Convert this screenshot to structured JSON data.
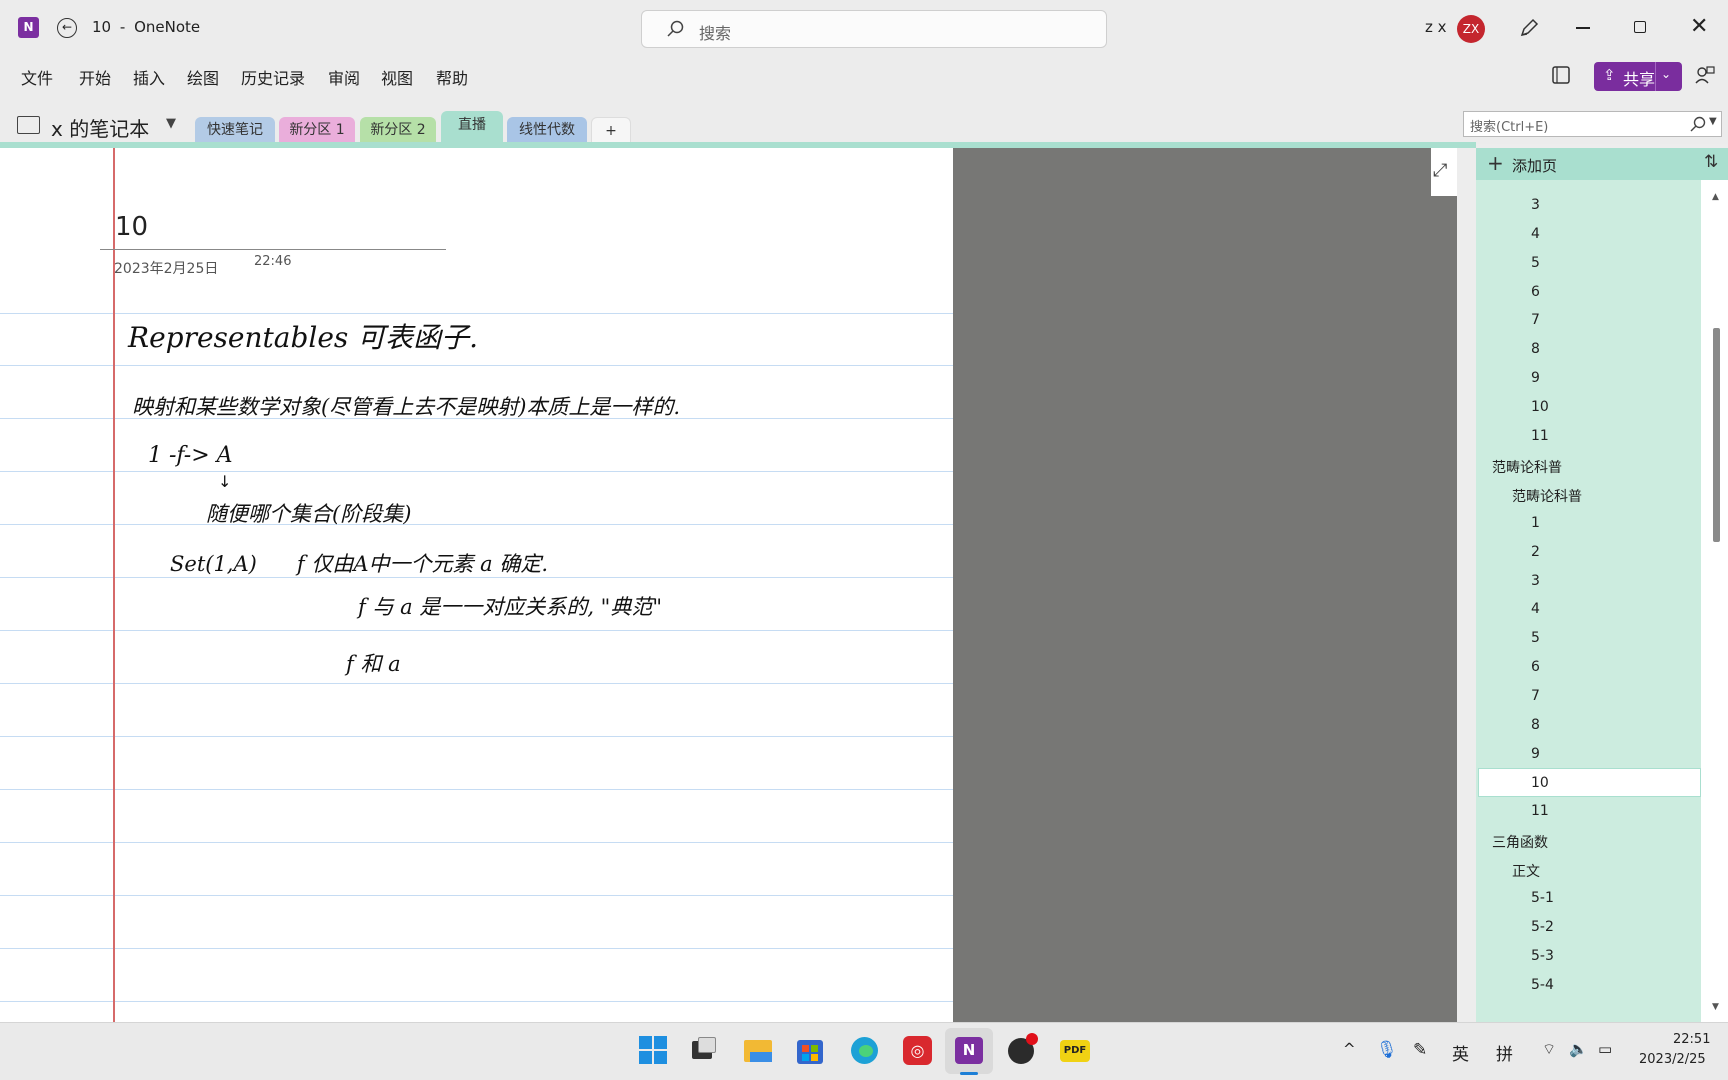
{
  "window": {
    "page_name": "10",
    "separator": "-",
    "app_name": "OneNote",
    "user_initials_text": "z x",
    "avatar_initials": "ZX"
  },
  "search": {
    "placeholder": "搜索"
  },
  "menu": [
    "文件",
    "开始",
    "插入",
    "绘图",
    "历史记录",
    "审阅",
    "视图",
    "帮助"
  ],
  "share_label": "共享",
  "notebook": {
    "name": "x 的笔记本",
    "sections": [
      {
        "label": "快速笔记",
        "color": "#b3cbe6"
      },
      {
        "label": "新分区 1",
        "color": "#eaaedb"
      },
      {
        "label": "新分区 2",
        "color": "#b6e0a8"
      },
      {
        "label": "直播",
        "color": "#a9dfcf"
      },
      {
        "label": "线性代数",
        "color": "#a9c5e6"
      }
    ],
    "add_section": "+"
  },
  "page_search": {
    "placeholder": "搜索(Ctrl+E)"
  },
  "page": {
    "title": "10",
    "date": "2023年2月25日",
    "time": "22:46",
    "ink": [
      "Representables   可表函子.",
      "映射和某些数学对象(尽管看上去不是映射)本质上是一样的.",
      "1 -f-> A",
      "随便哪个集合(阶段集)",
      "Set(1,A)      f 仅由A中一个元素 a 确定.",
      "f 与 a 是一一对应关系的, \"典范\"",
      "f 和 a"
    ]
  },
  "pagelist": {
    "add_page": "添加页",
    "items": [
      {
        "label": "3",
        "level": 2
      },
      {
        "label": "4",
        "level": 2
      },
      {
        "label": "5",
        "level": 2
      },
      {
        "label": "6",
        "level": 2
      },
      {
        "label": "7",
        "level": 2
      },
      {
        "label": "8",
        "level": 2
      },
      {
        "label": "9",
        "level": 2
      },
      {
        "label": "10",
        "level": 2
      },
      {
        "label": "11",
        "level": 2
      },
      {
        "label": "范畴论科普",
        "level": 0
      },
      {
        "label": "范畴论科普",
        "level": 1
      },
      {
        "label": "1",
        "level": 2
      },
      {
        "label": "2",
        "level": 2
      },
      {
        "label": "3",
        "level": 2
      },
      {
        "label": "4",
        "level": 2
      },
      {
        "label": "5",
        "level": 2
      },
      {
        "label": "6",
        "level": 2
      },
      {
        "label": "7",
        "level": 2
      },
      {
        "label": "8",
        "level": 2
      },
      {
        "label": "9",
        "level": 2
      },
      {
        "label": "10",
        "level": 2,
        "selected": true
      },
      {
        "label": "11",
        "level": 2
      },
      {
        "label": "三角函数",
        "level": 0
      },
      {
        "label": "正文",
        "level": 1
      },
      {
        "label": "5-1",
        "level": 2
      },
      {
        "label": "5-2",
        "level": 2
      },
      {
        "label": "5-3",
        "level": 2
      },
      {
        "label": "5-4",
        "level": 2
      }
    ]
  },
  "taskbar": {
    "ime_lang": "英",
    "ime_mode": "拼",
    "time": "22:51",
    "date": "2023/2/25"
  },
  "colors": {
    "accent_purple": "#7a2d9e",
    "section_green": "#a9dfcf",
    "margin_red": "#d66a6a",
    "rule_blue": "#c6dcf3"
  }
}
